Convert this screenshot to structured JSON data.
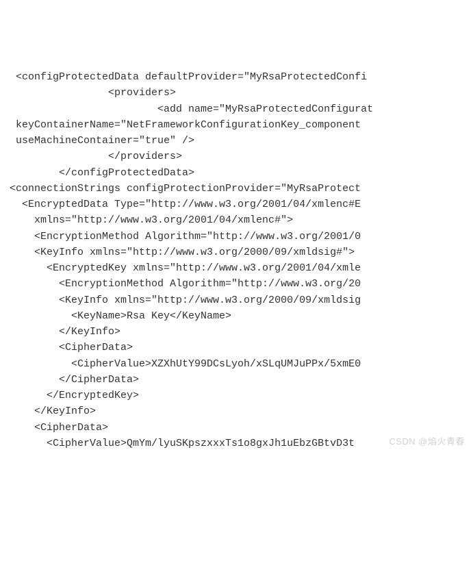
{
  "code": {
    "lines": [
      " <configProtectedData defaultProvider=\"MyRsaProtectedConfi",
      "                <providers>",
      "                        <add name=\"MyRsaProtectedConfigurat",
      " keyContainerName=\"NetFrameworkConfigurationKey_component",
      " useMachineContainer=\"true\" />",
      "                </providers>",
      "        </configProtectedData>",
      "<connectionStrings configProtectionProvider=\"MyRsaProtect",
      "  <EncryptedData Type=\"http://www.w3.org/2001/04/xmlenc#E",
      "    xmlns=\"http://www.w3.org/2001/04/xmlenc#\">",
      "    <EncryptionMethod Algorithm=\"http://www.w3.org/2001/0",
      "    <KeyInfo xmlns=\"http://www.w3.org/2000/09/xmldsig#\">",
      "      <EncryptedKey xmlns=\"http://www.w3.org/2001/04/xmle",
      "        <EncryptionMethod Algorithm=\"http://www.w3.org/20",
      "        <KeyInfo xmlns=\"http://www.w3.org/2000/09/xmldsig",
      "          <KeyName>Rsa Key</KeyName>",
      "        </KeyInfo>",
      "        <CipherData>",
      "          <CipherValue>XZXhUtY99DCsLyoh/xSLqUMJuPPx/5xmE0",
      "        </CipherData>",
      "      </EncryptedKey>",
      "    </KeyInfo>",
      "    <CipherData>",
      "      <CipherValue>QmYm/lyuSKpszxxxTs1o8gxJh1uEbzGBtvD3t"
    ]
  },
  "watermark": "CSDN @焰火青春"
}
